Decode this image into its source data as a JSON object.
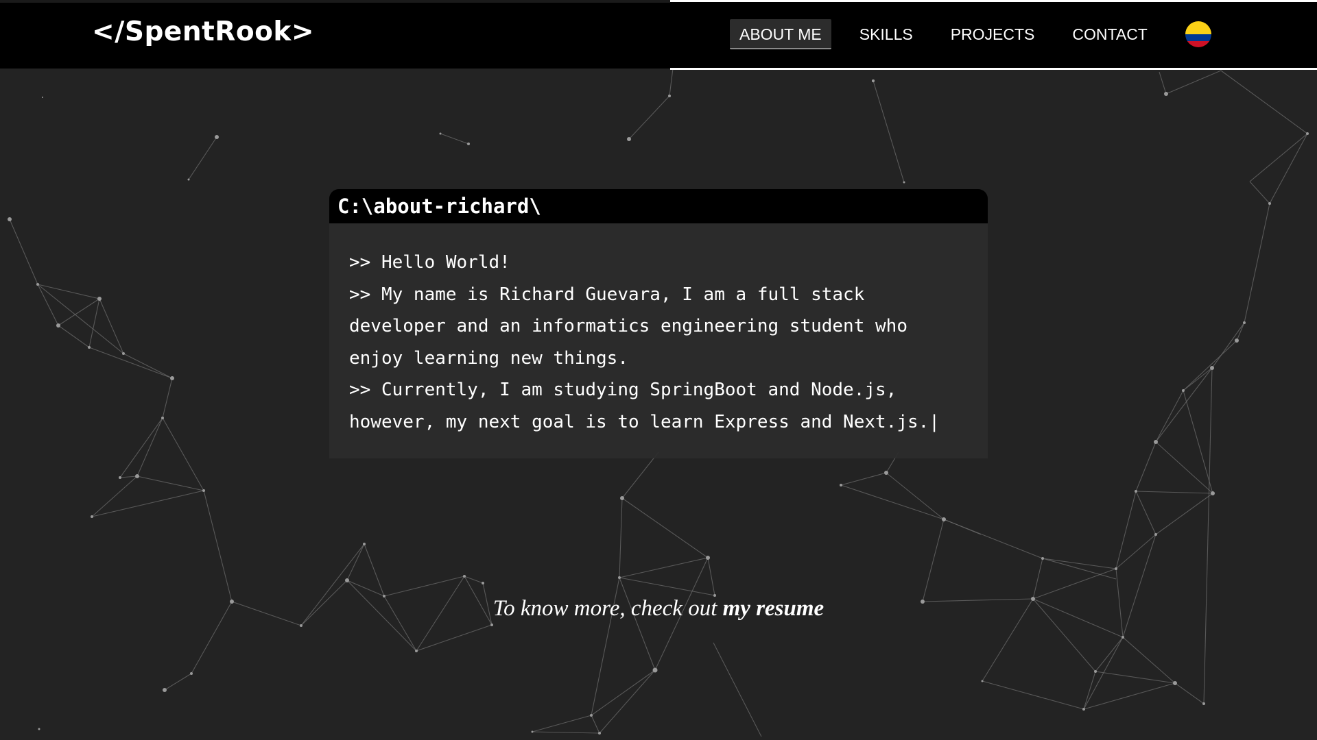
{
  "header": {
    "logo": "</SpentRook>",
    "nav": [
      {
        "label": "ABOUT ME",
        "active": true
      },
      {
        "label": "SKILLS",
        "active": false
      },
      {
        "label": "PROJECTS",
        "active": false
      },
      {
        "label": "CONTACT",
        "active": false
      }
    ],
    "language_icon": "colombia-flag-icon",
    "flag_colors": [
      "#FCD116",
      "#003893",
      "#CE1126"
    ]
  },
  "terminal": {
    "title": "C:\\about-richard\\",
    "lines": [
      ">> Hello World!",
      ">> My name is Richard Guevara, I am a full stack developer and an informatics engineering student who enjoy learning new things.",
      ">> Currently, I am studying SpringBoot and Node.js, however, my next goal is to learn Express and Next.js."
    ],
    "cursor": "|"
  },
  "footer_cta": {
    "text": "To know more, check out",
    "link_label": "my resume"
  },
  "colors": {
    "background": "#232323",
    "header": "#000000",
    "terminal_body": "#2c2c2c",
    "text": "#ffffff"
  }
}
